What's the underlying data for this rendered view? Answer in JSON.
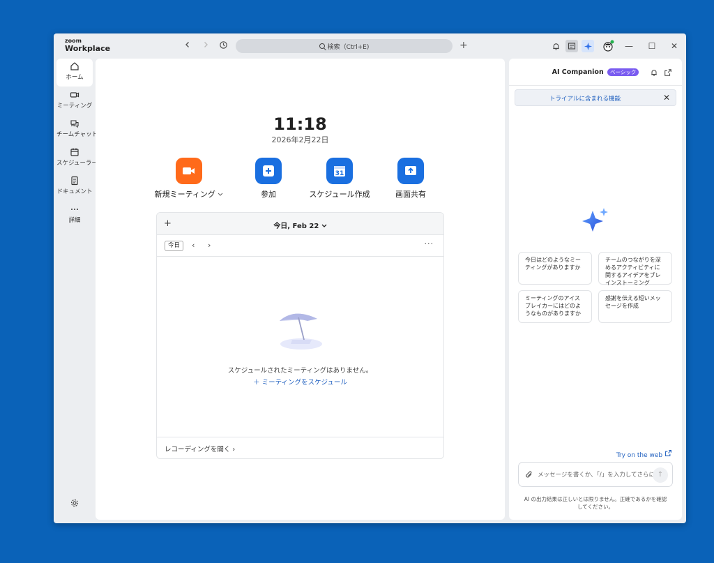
{
  "app": {
    "logo_top": "zoom",
    "logo_bottom": "Workplace"
  },
  "titlebar": {
    "search_label": "検索（Ctrl+E)",
    "back_icon": "chevron-left-icon",
    "forward_icon": "chevron-right-icon",
    "history_icon": "history-icon",
    "new_tab_label": "+",
    "minimize_label": "—",
    "maximize_label": "☐",
    "close_label": "✕"
  },
  "sidebar": {
    "items": [
      {
        "label": "ホーム",
        "icon": "home-icon"
      },
      {
        "label": "ミーティング",
        "icon": "video-icon"
      },
      {
        "label": "チームチャット",
        "icon": "chat-icon"
      },
      {
        "label": "スケジューラー",
        "icon": "calendar-icon"
      },
      {
        "label": "ドキュメント",
        "icon": "document-icon"
      },
      {
        "label": "詳細",
        "icon": "more-icon"
      }
    ]
  },
  "main": {
    "time": "11:18",
    "date": "2026年2月22日",
    "actions": [
      {
        "label": "新規ミーティング",
        "color": "#ff6a1a"
      },
      {
        "label": "参加",
        "color": "#1a6fe0"
      },
      {
        "label": "スケジュール作成",
        "color": "#1a6fe0"
      },
      {
        "label": "画面共有",
        "color": "#1a6fe0"
      }
    ],
    "calendar": {
      "add_label": "+",
      "title": "今日, Feb 22",
      "today_label": "今日",
      "prev_label": "‹",
      "next_label": "›",
      "more_label": "···",
      "empty_text": "スケジュールされたミーティングはありません。",
      "schedule_link": "＋ ミーティングをスケジュール",
      "recordings_link": "レコーディングを開く ›"
    }
  },
  "ai": {
    "title": "AI Companion",
    "badge": "ベーシック",
    "trial_text": "トライアルに含まれる機能",
    "close_label": "✕",
    "suggestions": [
      "今日はどのようなミーティングがありますか",
      "チームのつながりを深めるアクティビティに関するアイデアをブレインストーミング",
      "ミーティングのアイスブレイカーにはどのようなものがありますか",
      "感謝を伝える短いメッセージを作成"
    ],
    "web_link": "Try on the web",
    "input_placeholder": "メッセージを書くか、「/」を入力してさらに...",
    "send_label": "↑",
    "disclaimer": "AI の出力結果は正しいとは限りません。正確であるかを確認してください。"
  },
  "colors": {
    "accent": "#1a6fe0",
    "new_meeting": "#ff6a1a",
    "desktop": "#0a62b8"
  }
}
